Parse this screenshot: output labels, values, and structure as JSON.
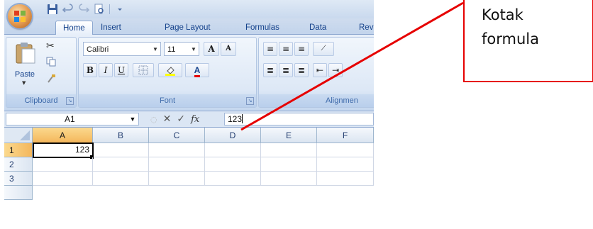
{
  "ribbon": {
    "tabs": [
      "Home",
      "Insert",
      "Page Layout",
      "Formulas",
      "Data",
      "Revi"
    ],
    "clipboard": {
      "paste_label": "Paste",
      "group_label": "Clipboard"
    },
    "font": {
      "font_name": "Calibri",
      "font_size": "11",
      "bold": "B",
      "italic": "I",
      "underline": "U",
      "grow": "A",
      "shrink": "A",
      "group_label": "Font"
    },
    "alignment": {
      "group_label": "Alignmen"
    }
  },
  "formula_bar": {
    "name_box": "A1",
    "fx_symbol": "fx",
    "content": "123"
  },
  "sheet": {
    "columns": [
      "A",
      "B",
      "C",
      "D",
      "E",
      "F"
    ],
    "rows": [
      "1",
      "2",
      "3"
    ],
    "cells": {
      "A1": "123"
    }
  },
  "annotation": {
    "text": "Kotak\nformula",
    "color": "#e60000"
  },
  "colors": {
    "ribbon_text": "#15428b",
    "selected_header": "#f4b75c",
    "annotation": "#e60000"
  }
}
